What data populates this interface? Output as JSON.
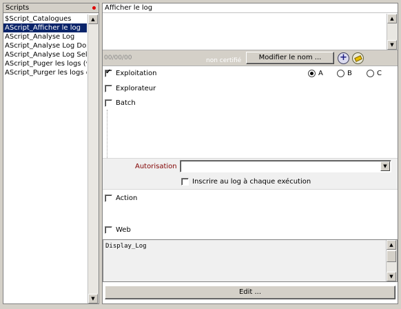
{
  "scripts_panel": {
    "header": "Scripts",
    "items": [
      "$Script_Catalogues",
      "AScript_Afficher le log",
      "AScript_Analyse Log",
      "AScript_Analyse Log Dos",
      "AScript_Analyse Log Sel",
      "AScript_Puger les logs (v",
      "AScript_Purger les logs d"
    ],
    "selected_index": 1
  },
  "script_detail": {
    "title": "Afficher le log",
    "description": "",
    "date": "00/00/00",
    "certified_status": "non certifié",
    "rename_button": "Modifier le nom ...",
    "add_icon": "plus-circle-icon",
    "clear_icon": "eraser-icon"
  },
  "modes": {
    "exploitation": {
      "label": "Exploitation",
      "checked": true
    },
    "explorateur": {
      "label": "Explorateur",
      "checked": false
    },
    "batch": {
      "label": "Batch",
      "checked": false
    },
    "action": {
      "label": "Action",
      "checked": false
    },
    "web": {
      "label": "Web",
      "checked": false
    }
  },
  "levels": {
    "options": [
      "A",
      "B",
      "C"
    ],
    "selected": "A"
  },
  "authorisation": {
    "label": "Autorisation",
    "value": "",
    "log_each_run_label": "Inscrire au log à chaque exécution",
    "log_each_run_checked": false
  },
  "code": {
    "text": "Display_Log"
  },
  "edit_button": "Edit ...",
  "colors": {
    "window_bg": "#d4d0c8",
    "selection": "#0a246a",
    "auth_label": "#800000",
    "status_dot": "#e00000"
  }
}
